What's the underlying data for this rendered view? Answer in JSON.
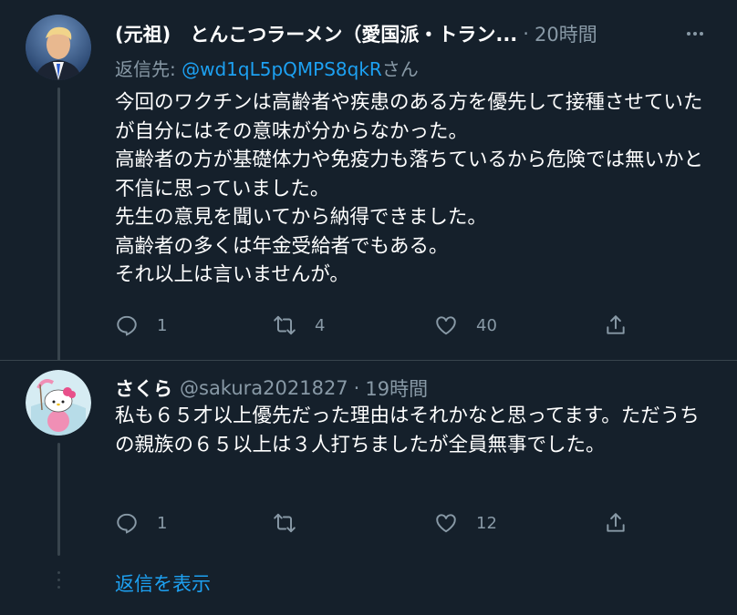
{
  "tweets": [
    {
      "author_name": "(元祖)　とんこつラーメン（愛国派・トラン...",
      "separator": "·",
      "time": "20時間",
      "more_icon": "more-icon",
      "reply_to_label": "返信先: ",
      "reply_to_handle": "@wd1qL5pQMPS8qkR",
      "reply_to_suffix": "さん",
      "text": "今回のワクチンは高齢者や疾患のある方を優先して接種させていたが自分にはその意味が分からなかった。\n高齢者の方が基礎体力や免疫力も落ちているから危険では無いかと不信に思っていました。\n先生の意見を聞いてから納得できました。\n高齢者の多くは年金受給者でもある。\nそれ以上は言いませんが。",
      "reply_count": "1",
      "retweet_count": "4",
      "like_count": "40"
    },
    {
      "author_name": "さくら",
      "author_handle": "@sakura2021827",
      "separator": "·",
      "time": "19時間",
      "text": "私も６５才以上優先だった理由はそれかなと思ってます。ただうちの親族の６５以上は３人打ちましたが全員無事でした。",
      "reply_count": "1",
      "retweet_count": "",
      "like_count": "12"
    }
  ],
  "show_replies_label": "返信を表示",
  "colors": {
    "background": "#15202b",
    "text": "#ffffff",
    "secondary": "#8899a6",
    "accent": "#1da1f2",
    "border": "#38444d"
  }
}
